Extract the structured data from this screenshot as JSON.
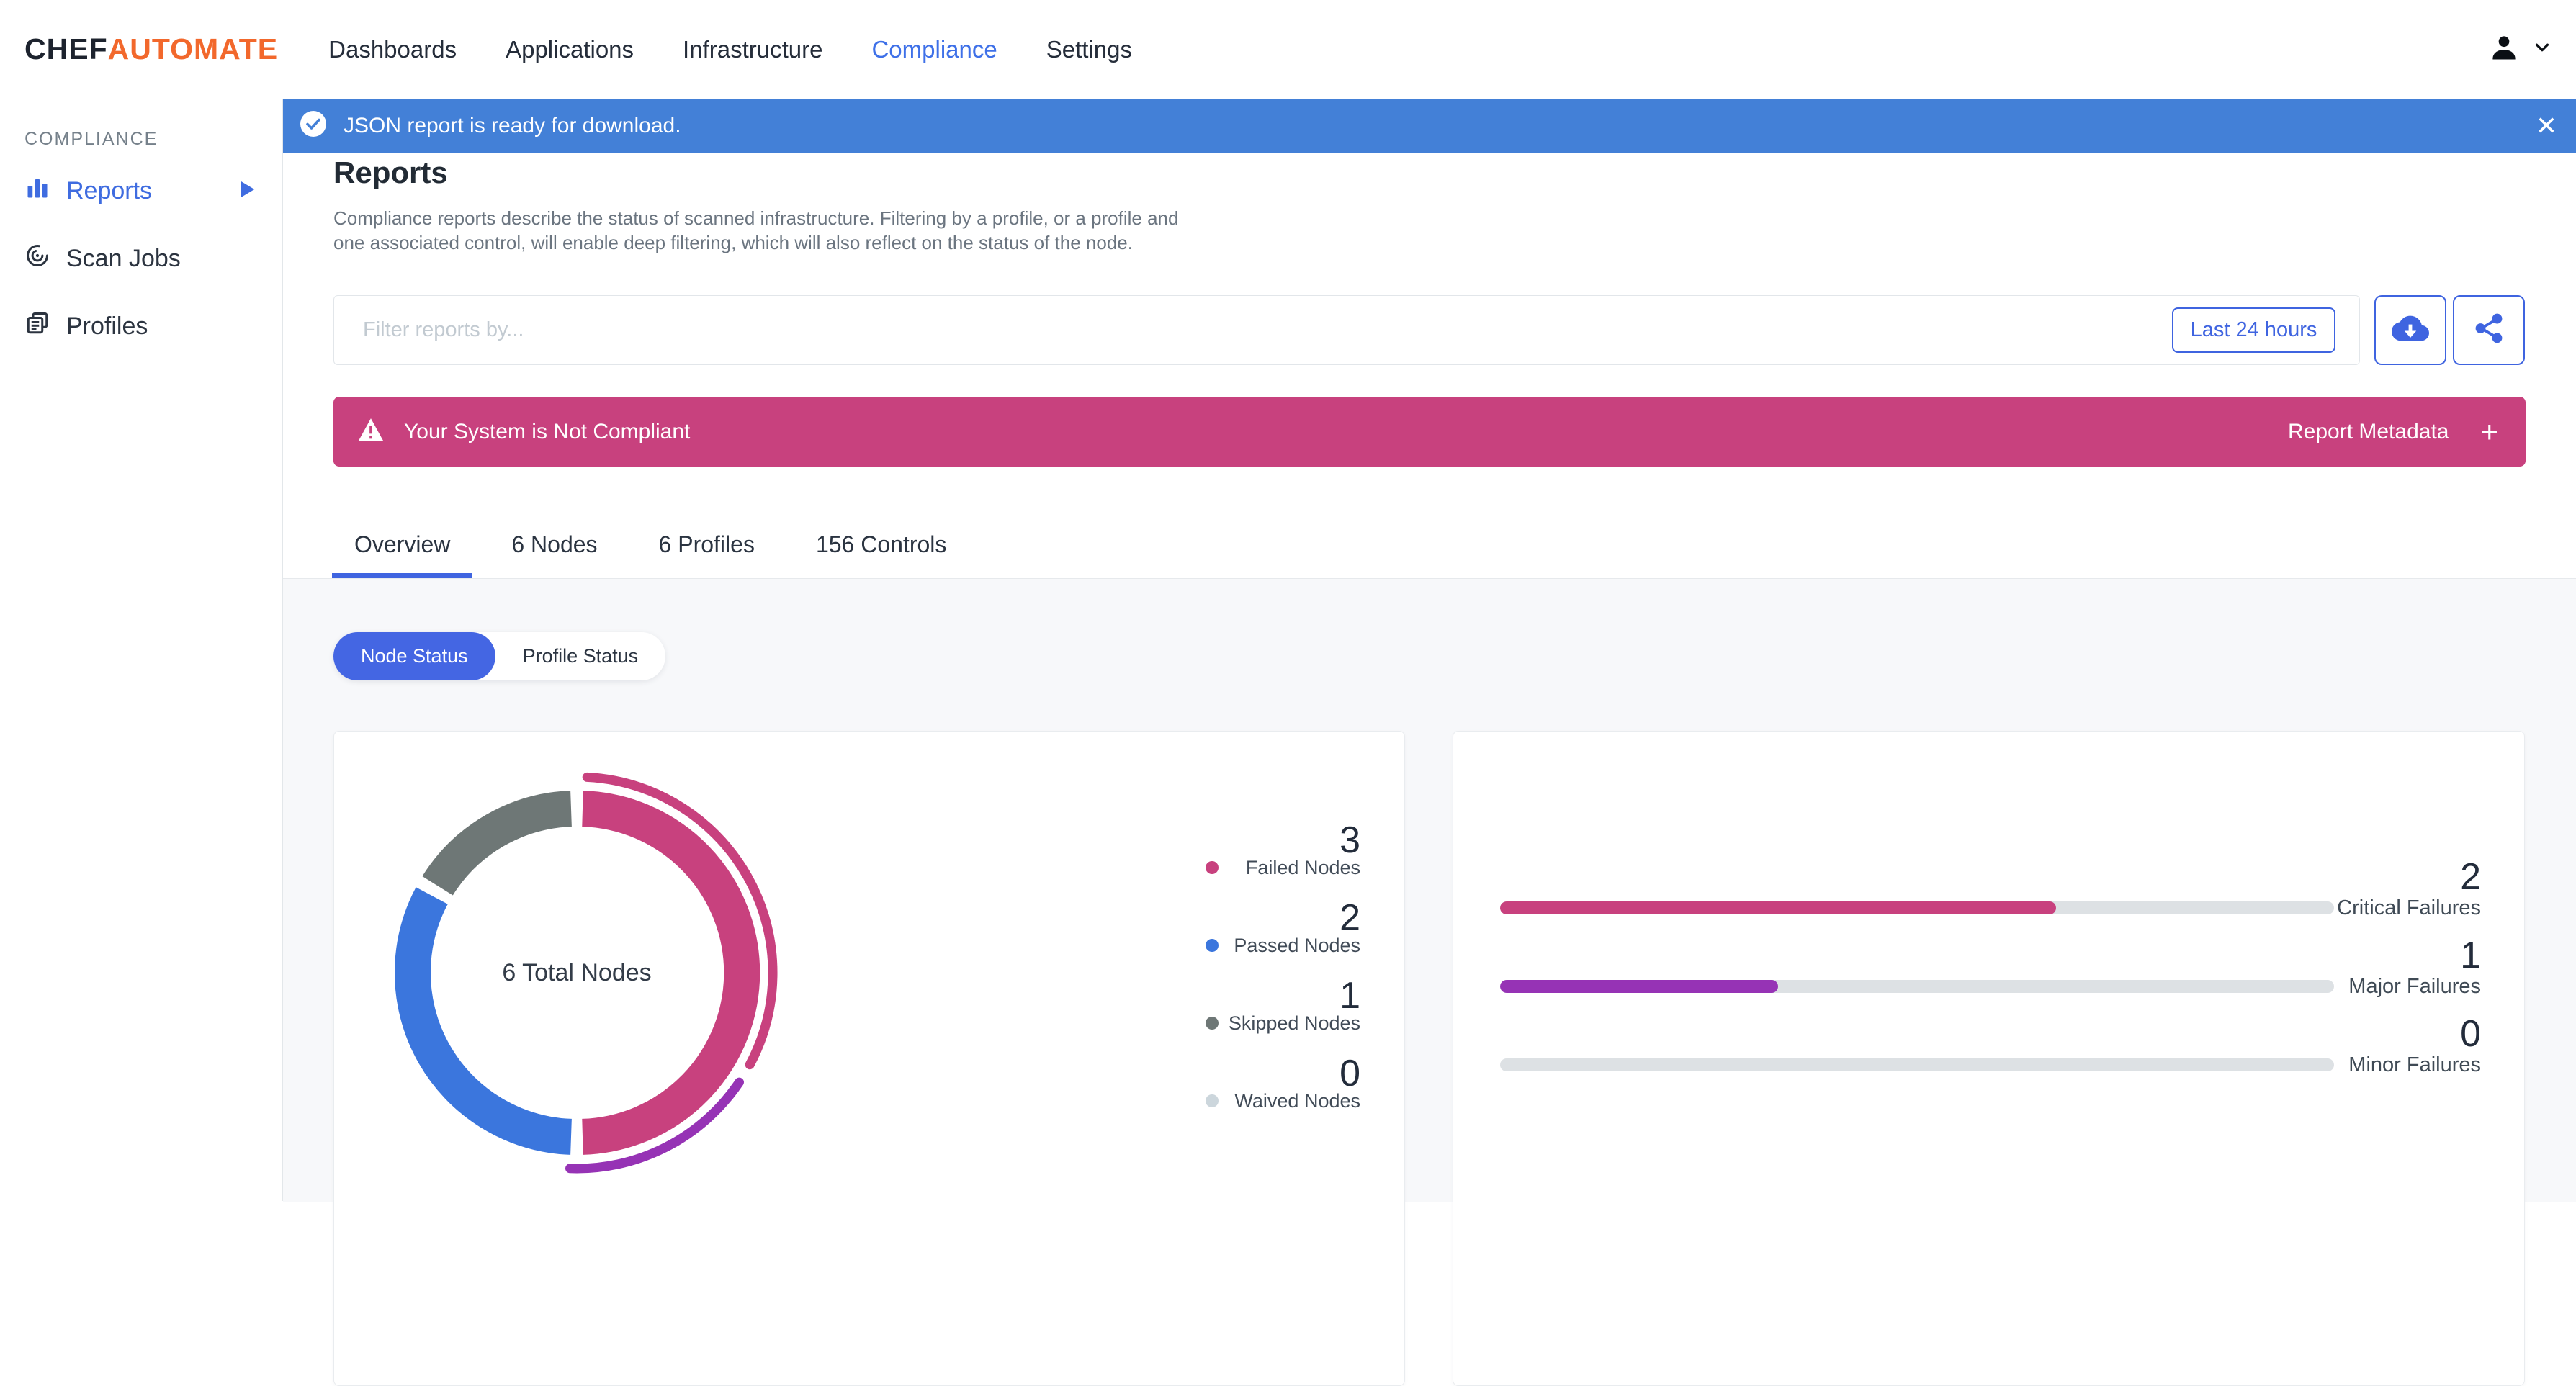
{
  "app": {
    "brand_chef": "CHEF",
    "brand_automate": "AUTOMATE"
  },
  "nav": {
    "items": [
      {
        "label": "Dashboards",
        "active": false
      },
      {
        "label": "Applications",
        "active": false
      },
      {
        "label": "Infrastructure",
        "active": false
      },
      {
        "label": "Compliance",
        "active": true
      },
      {
        "label": "Settings",
        "active": false
      }
    ]
  },
  "notification": {
    "message": "JSON report is ready for download.",
    "close_symbol": "✕"
  },
  "sidebar": {
    "section": "COMPLIANCE",
    "items": [
      {
        "label": "Reports",
        "active": true
      },
      {
        "label": "Scan Jobs",
        "active": false
      },
      {
        "label": "Profiles",
        "active": false
      }
    ]
  },
  "page": {
    "title": "Reports",
    "description_lines": [
      "Compliance reports describe the status of scanned infrastructure. Filtering by a profile, or a profile and",
      "one associated control, will enable deep filtering, which will also reflect on the status of the node."
    ]
  },
  "filters": {
    "placeholder": "Filter reports by...",
    "time_range_label": "Last 24 hours"
  },
  "compliance_banner": {
    "message": "Your System is Not Compliant",
    "metadata_label": "Report Metadata",
    "expand_symbol": "+"
  },
  "tabs": [
    {
      "label": "Overview",
      "active": true
    },
    {
      "label": "6 Nodes",
      "active": false
    },
    {
      "label": "6 Profiles",
      "active": false
    },
    {
      "label": "156 Controls",
      "active": false
    }
  ],
  "status_toggle": [
    {
      "label": "Node Status",
      "active": true
    },
    {
      "label": "Profile Status",
      "active": false
    }
  ],
  "colors": {
    "primary_blue": "#3f64e0",
    "banner_blue": "#4380d7",
    "failed_pink": "#c8417e",
    "major_purple": "#9633b5",
    "passed_blue": "#3b76dd",
    "skipped_gray": "#6e7776",
    "waived_gray": "#ccd6dc",
    "track_gray": "#dde1e4"
  },
  "chart_data": [
    {
      "type": "pie",
      "title": "Node Status",
      "center_label": "6 Total Nodes",
      "total": 6,
      "legend_position": "right",
      "segments": [
        {
          "label": "Failed Nodes",
          "value": 3,
          "color": "#c8417e"
        },
        {
          "label": "Passed Nodes",
          "value": 2,
          "color": "#3b76dd"
        },
        {
          "label": "Skipped Nodes",
          "value": 1,
          "color": "#6e7776"
        },
        {
          "label": "Waived Nodes",
          "value": 0,
          "color": "#ccd6dc"
        }
      ],
      "outer_arcs": [
        {
          "name": "critical-share",
          "color": "#c8417e",
          "start_deg": 3,
          "end_deg": 118
        },
        {
          "name": "major-share",
          "color": "#9633b5",
          "start_deg": 124,
          "end_deg": 182
        }
      ]
    },
    {
      "type": "bar",
      "title": "Failure Severity",
      "categories": [
        "Critical Failures",
        "Major Failures",
        "Minor Failures"
      ],
      "values": [
        2,
        1,
        0
      ],
      "max": 3,
      "colors": [
        "#c8417e",
        "#9633b5",
        "#dde1e4"
      ]
    }
  ]
}
